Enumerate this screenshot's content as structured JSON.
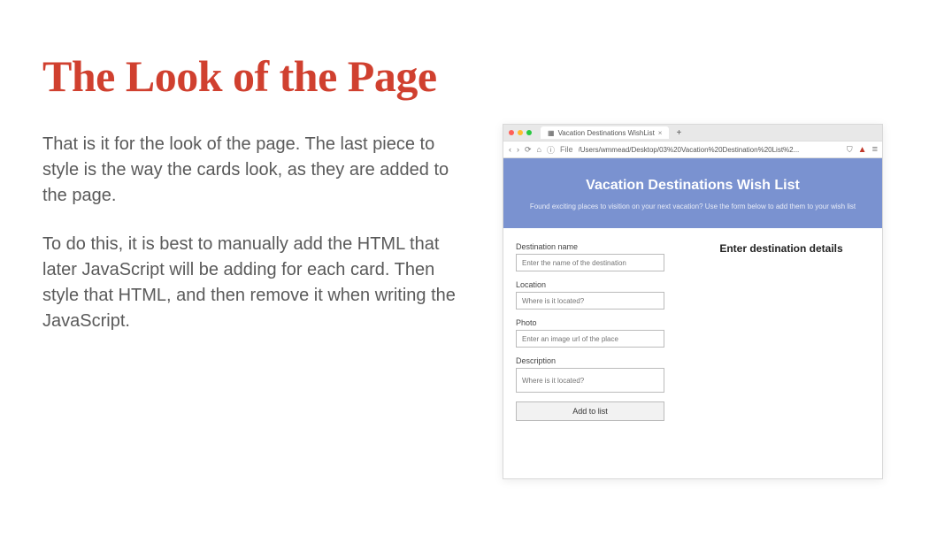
{
  "slide": {
    "headline": "The Look of the Page",
    "para1": "That is it for the look of the page. The last piece to style is the way the cards look, as they are added to the page.",
    "para2": "To do this, it is best to manually add the HTML that later JavaScript will be adding for each card. Then style that HTML, and then remove it when writing the JavaScript."
  },
  "browser": {
    "tab_title": "Vacation Destinations WishList",
    "tab_close": "×",
    "tab_plus": "+",
    "nav_back": "‹",
    "nav_fwd": "›",
    "reload": "⟳",
    "home": "⌂",
    "lock": "ⓘ",
    "url_prefix": "File",
    "url": "/Users/wmmead/Desktop/03%20Vacation%20Destination%20List%2...",
    "shield": "⛉",
    "warn": "▲",
    "menu": "≡"
  },
  "app": {
    "hero_title": "Vacation Destinations Wish List",
    "hero_sub": "Found exciting places to visition on your next vacation? Use the form below to add them to your wish list",
    "details_heading": "Enter destination details",
    "fields": {
      "dest_label": "Destination name",
      "dest_ph": "Enter the name of the destination",
      "loc_label": "Location",
      "loc_ph": "Where is it located?",
      "photo_label": "Photo",
      "photo_ph": "Enter an image url of the place",
      "desc_label": "Description",
      "desc_ph": "Where is it located?"
    },
    "add_btn": "Add to list"
  }
}
